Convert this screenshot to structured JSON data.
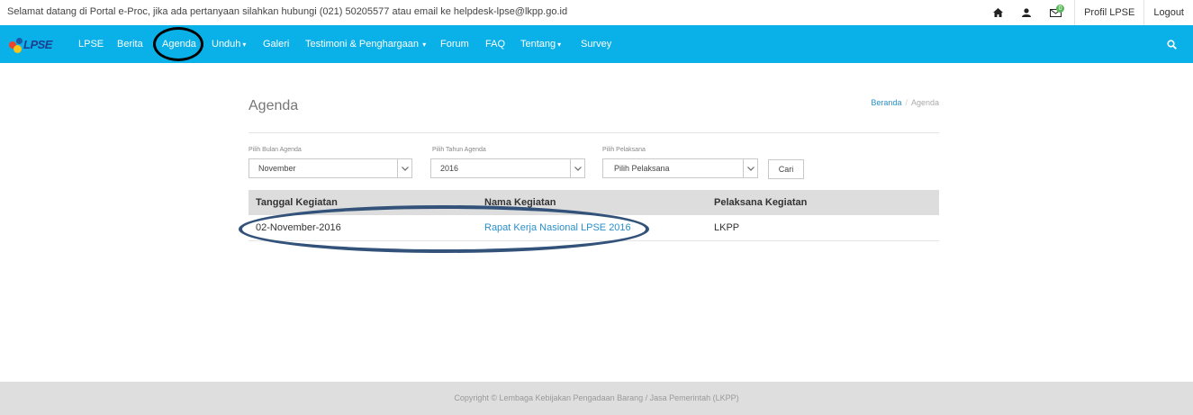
{
  "topbar": {
    "welcome": "Selamat datang di Portal e-Proc, jika ada pertanyaan silahkan hubungi (021) 50205577 atau email ke helpdesk-lpse@lkpp.go.id",
    "icons": [
      "home-icon",
      "user-icon",
      "mail-icon"
    ],
    "mail_badge": "0",
    "profil_label": "Profil LPSE",
    "logout_label": "Logout"
  },
  "nav": {
    "logo_text": "LPSE",
    "items": [
      {
        "label": "LPSE"
      },
      {
        "label": "Berita"
      },
      {
        "label": "Agenda",
        "active": true
      },
      {
        "label": "Unduh",
        "dropdown": true
      },
      {
        "label": "Galeri"
      },
      {
        "label": "Testimoni & Penghargaan",
        "dropdown": true
      },
      {
        "label": "Forum"
      },
      {
        "label": "FAQ"
      },
      {
        "label": "Tentang",
        "dropdown": true
      },
      {
        "label": "Survey"
      }
    ],
    "color": "#0ab0e8"
  },
  "page": {
    "title": "Agenda",
    "breadcrumb": {
      "home": "Beranda",
      "separator": "/",
      "current": "Agenda"
    }
  },
  "filters": {
    "bulan": {
      "label": "Pilih Bulan Agenda",
      "value": "November"
    },
    "tahun": {
      "label": "Pilih Tahun Agenda",
      "value": "2016"
    },
    "pelaksana": {
      "label": "Pilih Pelaksana",
      "value": "Pilih Pelaksana"
    },
    "button": "Cari"
  },
  "table": {
    "headers": [
      "Tanggal Kegiatan",
      "Nama Kegiatan",
      "Pelaksana Kegiatan"
    ],
    "rows": [
      [
        "02-November-2016",
        "Rapat Kerja Nasional LPSE 2016",
        "LKPP"
      ]
    ]
  },
  "footer": {
    "text": "Copyright © Lembaga Kebijakan Pengadaan Barang / Jasa Pemerintah (LKPP)"
  }
}
